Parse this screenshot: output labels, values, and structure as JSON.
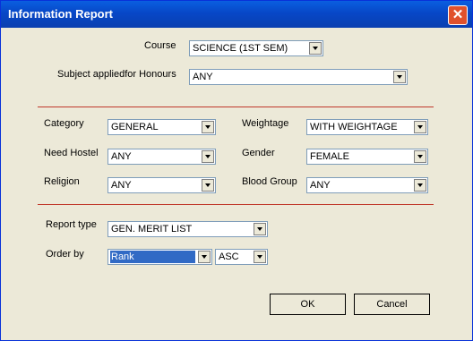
{
  "window": {
    "title": "Information Report",
    "close_symbol": "✕"
  },
  "course": {
    "label": "Course",
    "value": "SCIENCE (1ST SEM)"
  },
  "honours": {
    "label": "Subject appliedfor Honours",
    "value": "ANY"
  },
  "category": {
    "label": "Category",
    "value": "GENERAL"
  },
  "weightage": {
    "label": "Weightage",
    "value": "WITH WEIGHTAGE"
  },
  "need_hostel": {
    "label": "Need Hostel",
    "value": "ANY"
  },
  "gender": {
    "label": "Gender",
    "value": "FEMALE"
  },
  "religion": {
    "label": "Religion",
    "value": "ANY"
  },
  "blood_group": {
    "label": "Blood Group",
    "value": "ANY"
  },
  "report_type": {
    "label": "Report type",
    "value": "GEN. MERIT LIST"
  },
  "order_by": {
    "label": "Order by",
    "value": "Rank",
    "direction": "ASC"
  },
  "buttons": {
    "ok": "OK",
    "cancel": "Cancel"
  },
  "colors": {
    "titlebar": "#0747c7",
    "separator": "#c0392b",
    "selection": "#316ac5",
    "background": "#ece9d8"
  }
}
